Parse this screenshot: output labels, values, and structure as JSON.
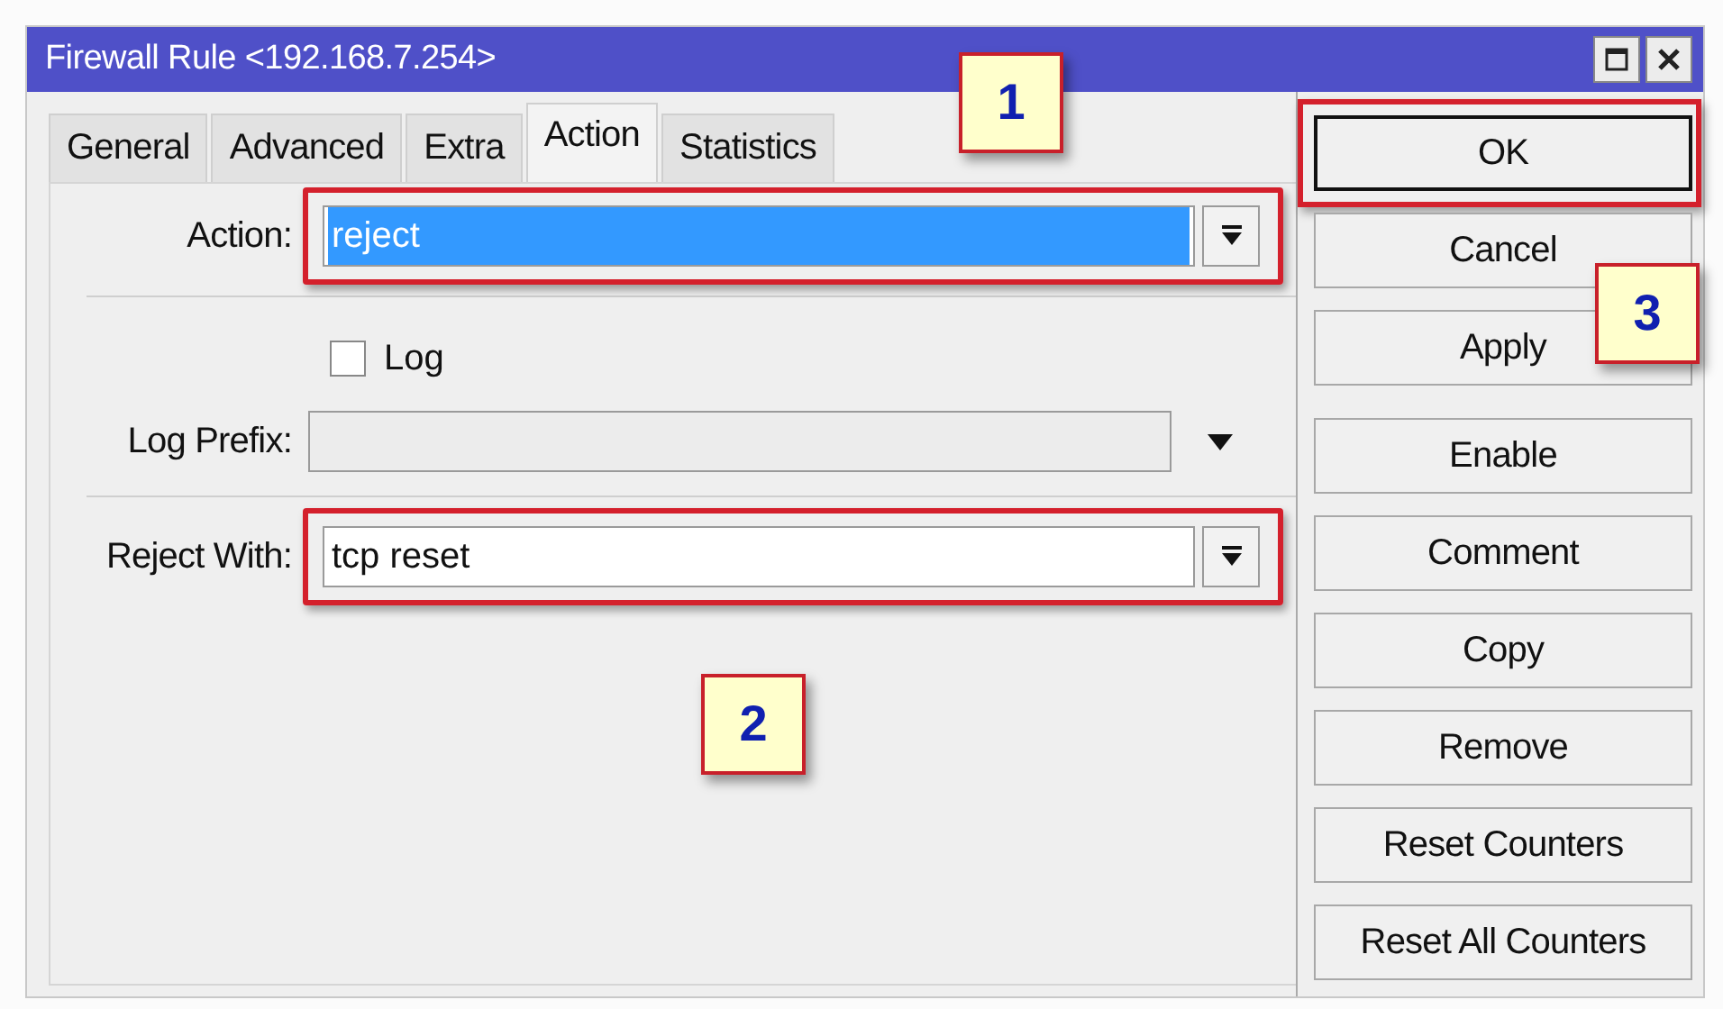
{
  "window": {
    "title": "Firewall Rule <192.168.7.254>"
  },
  "tabs": [
    {
      "label": "General",
      "selected": false
    },
    {
      "label": "Advanced",
      "selected": false
    },
    {
      "label": "Extra",
      "selected": false
    },
    {
      "label": "Action",
      "selected": true
    },
    {
      "label": "Statistics",
      "selected": false
    }
  ],
  "fields": [
    {
      "kind": "combo",
      "label": "Action:",
      "value": "reject",
      "text_selected": true,
      "highlighted": true,
      "divider_after": true
    },
    {
      "kind": "checkbox",
      "label": "Log",
      "checked": false,
      "divider_after": false
    },
    {
      "kind": "text-dropdown",
      "label": "Log Prefix:",
      "divider_after": true
    },
    {
      "kind": "combo",
      "label": "Reject With:",
      "value": "tcp reset",
      "text_selected": false,
      "highlighted": true,
      "divider_after": false
    }
  ],
  "button_groups": [
    [
      {
        "label": "OK",
        "default": true,
        "highlighted": true
      },
      {
        "label": "Cancel",
        "default": false,
        "highlighted": false
      },
      {
        "label": "Apply",
        "default": false,
        "highlighted": false
      }
    ],
    [
      {
        "label": "Enable",
        "default": false,
        "highlighted": false
      },
      {
        "label": "Comment",
        "default": false,
        "highlighted": false
      },
      {
        "label": "Copy",
        "default": false,
        "highlighted": false
      },
      {
        "label": "Remove",
        "default": false,
        "highlighted": false
      },
      {
        "label": "Reset Counters",
        "default": false,
        "highlighted": false
      },
      {
        "label": "Reset All Counters",
        "default": false,
        "highlighted": false
      }
    ]
  ],
  "callouts": [
    "1",
    "2",
    "3"
  ]
}
